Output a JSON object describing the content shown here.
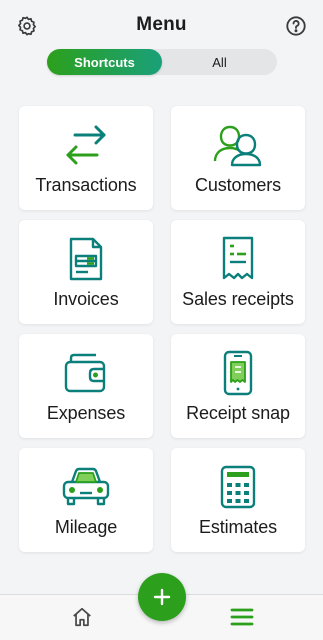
{
  "header": {
    "title": "Menu",
    "left_icon": "gear-icon",
    "right_icon": "help-icon"
  },
  "segment": {
    "options": [
      "Shortcuts",
      "All"
    ],
    "selected": "Shortcuts"
  },
  "shortcuts": [
    {
      "label": "Transactions",
      "icon": "transfer-arrows-icon"
    },
    {
      "label": "Customers",
      "icon": "customers-icon"
    },
    {
      "label": "Invoices",
      "icon": "invoice-icon"
    },
    {
      "label": "Sales receipts",
      "icon": "receipt-icon"
    },
    {
      "label": "Expenses",
      "icon": "wallet-icon"
    },
    {
      "label": "Receipt snap",
      "icon": "phone-receipt-icon"
    },
    {
      "label": "Mileage",
      "icon": "car-icon"
    },
    {
      "label": "Estimates",
      "icon": "calculator-icon"
    }
  ],
  "tabbar": {
    "items": [
      {
        "icon": "home-icon",
        "active": false
      },
      {
        "icon": "menu-icon",
        "active": true
      }
    ],
    "fab_icon": "plus-icon"
  },
  "colors": {
    "brand_green": "#2ca01c",
    "teal": "#0b7f7a",
    "background": "#f3f4f6"
  }
}
